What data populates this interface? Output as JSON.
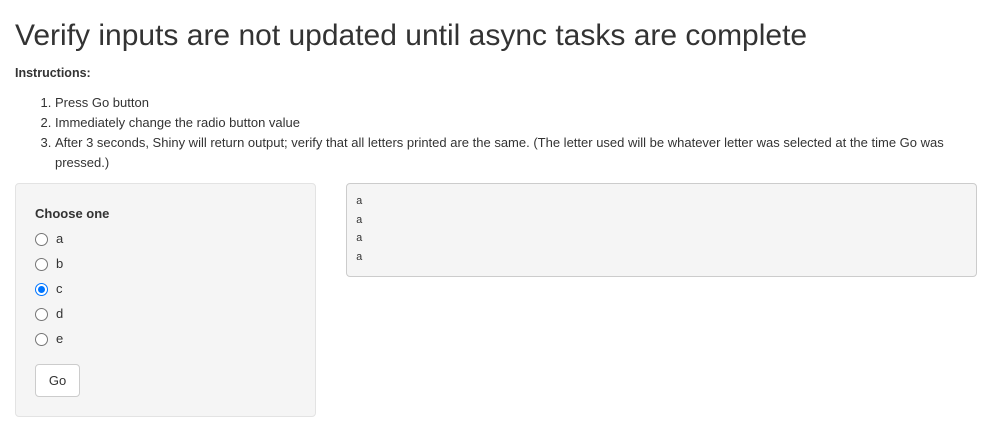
{
  "page": {
    "title": "Verify inputs are not updated until async tasks are complete",
    "instructions_heading": "Instructions:",
    "steps": [
      "Press Go button",
      "Immediately change the radio button value",
      "After 3 seconds, Shiny will return output; verify that all letters printed are the same. (The letter used will be whatever letter was selected at the time Go was pressed.)"
    ]
  },
  "sidebar": {
    "radio_label": "Choose one",
    "options": [
      {
        "label": "a",
        "checked": false
      },
      {
        "label": "b",
        "checked": false
      },
      {
        "label": "c",
        "checked": true
      },
      {
        "label": "d",
        "checked": false
      },
      {
        "label": "e",
        "checked": false
      }
    ],
    "go_label": "Go"
  },
  "output": {
    "lines": [
      "a",
      "a",
      "a",
      "a"
    ]
  },
  "colors": {
    "accent": "#0075ff",
    "panel_bg": "#f5f5f5",
    "text": "#333333"
  }
}
